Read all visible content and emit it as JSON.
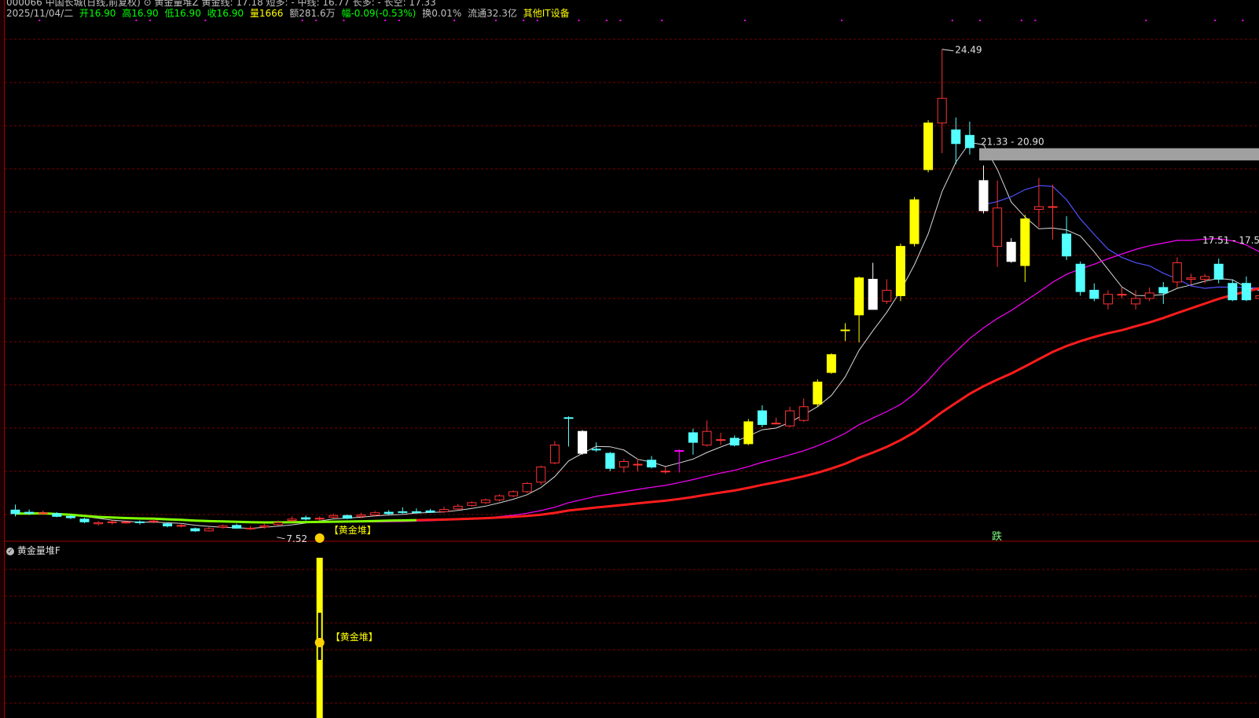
{
  "header": {
    "line1": "000066 中国长城(日线,前复权) ⊙ 黄金量堆Z  黄金线: 17.18  短多: -  中线: 16.77  长多: -  长空: 17.33",
    "date": "2025/11/04/二",
    "open_label": "开",
    "open": "16.90",
    "high_label": "高",
    "high": "16.90",
    "low_label": "低",
    "low": "16.90",
    "close_label": "收",
    "close": "16.90",
    "vol_label": "量",
    "vol": "1666",
    "amount_label": "额",
    "amount": "281.6万",
    "change_label": "幅",
    "change": "-0.09(-0.53%)",
    "turnover_label": "换",
    "turnover": "0.01%",
    "float_label": "流通",
    "float": "32.3亿",
    "sector": "其他IT设备"
  },
  "subchart": {
    "title": "黄金量堆F",
    "signal_label": "【黄金堆】"
  },
  "chart_data": {
    "type": "candlestick",
    "price_range": [
      6.8,
      25.6
    ],
    "annotations": {
      "high": "24.49",
      "low": "7.52",
      "zone": "21.33 - 20.90",
      "right_level": "17.51 - 17.5",
      "signal": "【黄金堆】",
      "marker": "跌"
    },
    "candles": [
      {
        "o": 7.68,
        "c": 7.55,
        "h": 7.88,
        "l": 7.45,
        "s": "cyan"
      },
      {
        "o": 7.6,
        "c": 7.56,
        "h": 7.7,
        "l": 7.5,
        "s": "cyan"
      },
      {
        "o": 7.56,
        "c": 7.58,
        "h": 7.66,
        "l": 7.5,
        "s": "red"
      },
      {
        "o": 7.55,
        "c": 7.45,
        "h": 7.6,
        "l": 7.42,
        "s": "cyan"
      },
      {
        "o": 7.45,
        "c": 7.4,
        "h": 7.52,
        "l": 7.35,
        "s": "cyan"
      },
      {
        "o": 7.35,
        "c": 7.25,
        "h": 7.4,
        "l": 7.2,
        "s": "cyan"
      },
      {
        "o": 7.18,
        "c": 7.22,
        "h": 7.28,
        "l": 7.12,
        "s": "red"
      },
      {
        "o": 7.22,
        "c": 7.25,
        "h": 7.3,
        "l": 7.15,
        "s": "red"
      },
      {
        "o": 7.22,
        "c": 7.24,
        "h": 7.3,
        "l": 7.18,
        "s": "red"
      },
      {
        "o": 7.25,
        "c": 7.22,
        "h": 7.3,
        "l": 7.15,
        "s": "cyan"
      },
      {
        "o": 7.25,
        "c": 7.28,
        "h": 7.35,
        "l": 7.2,
        "s": "red"
      },
      {
        "o": 7.18,
        "c": 7.1,
        "h": 7.22,
        "l": 7.05,
        "s": "cyan"
      },
      {
        "o": 7.1,
        "c": 7.12,
        "h": 7.18,
        "l": 7.05,
        "s": "red"
      },
      {
        "o": 7.0,
        "c": 6.92,
        "h": 7.04,
        "l": 6.88,
        "s": "cyan"
      },
      {
        "o": 6.92,
        "c": 7.0,
        "h": 7.05,
        "l": 6.9,
        "s": "red"
      },
      {
        "o": 7.05,
        "c": 7.1,
        "h": 7.15,
        "l": 7.0,
        "s": "red"
      },
      {
        "o": 7.12,
        "c": 7.02,
        "h": 7.18,
        "l": 7.0,
        "s": "cyan"
      },
      {
        "o": 7.0,
        "c": 7.02,
        "h": 7.1,
        "l": 6.95,
        "s": "red"
      },
      {
        "o": 7.06,
        "c": 7.1,
        "h": 7.2,
        "l": 7.0,
        "s": "red"
      },
      {
        "o": 7.15,
        "c": 7.22,
        "h": 7.3,
        "l": 7.1,
        "s": "red"
      },
      {
        "o": 7.3,
        "c": 7.35,
        "h": 7.45,
        "l": 7.25,
        "s": "red"
      },
      {
        "o": 7.4,
        "c": 7.35,
        "h": 7.48,
        "l": 7.3,
        "s": "cyan"
      },
      {
        "o": 7.35,
        "c": 7.38,
        "h": 7.45,
        "l": 7.3,
        "s": "red"
      },
      {
        "o": 7.42,
        "c": 7.48,
        "h": 7.55,
        "l": 7.38,
        "s": "red"
      },
      {
        "o": 7.48,
        "c": 7.38,
        "h": 7.52,
        "l": 7.35,
        "s": "cyan"
      },
      {
        "o": 7.45,
        "c": 7.5,
        "h": 7.58,
        "l": 7.4,
        "s": "red"
      },
      {
        "o": 7.5,
        "c": 7.58,
        "h": 7.65,
        "l": 7.45,
        "s": "red"
      },
      {
        "o": 7.6,
        "c": 7.55,
        "h": 7.68,
        "l": 7.5,
        "s": "cyan"
      },
      {
        "o": 7.62,
        "c": 7.6,
        "h": 7.78,
        "l": 7.55,
        "s": "cyan"
      },
      {
        "o": 7.62,
        "c": 7.62,
        "h": 7.74,
        "l": 7.55,
        "s": "cyan"
      },
      {
        "o": 7.65,
        "c": 7.6,
        "h": 7.72,
        "l": 7.58,
        "s": "cyan"
      },
      {
        "o": 7.62,
        "c": 7.7,
        "h": 7.8,
        "l": 7.58,
        "s": "red"
      },
      {
        "o": 7.72,
        "c": 7.82,
        "h": 7.9,
        "l": 7.68,
        "s": "red"
      },
      {
        "o": 7.85,
        "c": 7.95,
        "h": 8.0,
        "l": 7.8,
        "s": "red"
      },
      {
        "o": 7.95,
        "c": 8.05,
        "h": 8.1,
        "l": 7.9,
        "s": "red"
      },
      {
        "o": 8.05,
        "c": 8.2,
        "h": 8.25,
        "l": 8.0,
        "s": "red"
      },
      {
        "o": 8.2,
        "c": 8.35,
        "h": 8.4,
        "l": 8.15,
        "s": "red"
      },
      {
        "o": 8.35,
        "c": 8.65,
        "h": 8.7,
        "l": 8.3,
        "s": "red"
      },
      {
        "o": 8.7,
        "c": 9.25,
        "h": 9.3,
        "l": 8.6,
        "s": "red"
      },
      {
        "o": 9.4,
        "c": 10.05,
        "h": 10.2,
        "l": 9.35,
        "s": "red"
      },
      {
        "o": 11.05,
        "c": 11.05,
        "h": 11.1,
        "l": 10.0,
        "s": "cyan"
      },
      {
        "o": 10.55,
        "c": 9.75,
        "h": 10.6,
        "l": 9.7,
        "s": "white"
      },
      {
        "o": 9.9,
        "c": 9.9,
        "h": 10.15,
        "l": 9.8,
        "s": "cyan"
      },
      {
        "o": 9.75,
        "c": 9.2,
        "h": 9.8,
        "l": 9.1,
        "s": "cyan"
      },
      {
        "o": 9.25,
        "c": 9.45,
        "h": 9.55,
        "l": 9.05,
        "s": "red"
      },
      {
        "o": 9.35,
        "c": 9.35,
        "h": 9.55,
        "l": 9.1,
        "s": "red"
      },
      {
        "o": 9.5,
        "c": 9.25,
        "h": 9.65,
        "l": 9.2,
        "s": "cyan"
      },
      {
        "o": 9.1,
        "c": 9.1,
        "h": 9.25,
        "l": 9.0,
        "s": "red"
      },
      {
        "o": 9.85,
        "c": 9.85,
        "h": 9.9,
        "l": 9.05,
        "s": "magenta"
      },
      {
        "o": 10.5,
        "c": 10.15,
        "h": 10.65,
        "l": 9.7,
        "s": "cyan"
      },
      {
        "o": 10.05,
        "c": 10.55,
        "h": 10.95,
        "l": 10.0,
        "s": "red"
      },
      {
        "o": 10.25,
        "c": 10.25,
        "h": 10.5,
        "l": 10.05,
        "s": "red"
      },
      {
        "o": 10.3,
        "c": 10.05,
        "h": 10.4,
        "l": 10.0,
        "s": "cyan"
      },
      {
        "o": 10.1,
        "c": 10.9,
        "h": 11.0,
        "l": 10.05,
        "s": "yellow"
      },
      {
        "o": 10.8,
        "c": 11.3,
        "h": 11.5,
        "l": 10.7,
        "s": "cyan"
      },
      {
        "o": 10.85,
        "c": 10.85,
        "h": 11.05,
        "l": 10.8,
        "s": "red"
      },
      {
        "o": 10.75,
        "c": 11.3,
        "h": 11.45,
        "l": 10.7,
        "s": "red"
      },
      {
        "o": 10.95,
        "c": 11.45,
        "h": 11.75,
        "l": 10.9,
        "s": "red"
      },
      {
        "o": 11.55,
        "c": 12.35,
        "h": 12.45,
        "l": 11.45,
        "s": "yellow"
      },
      {
        "o": 12.7,
        "c": 13.35,
        "h": 13.4,
        "l": 12.65,
        "s": "yellow"
      },
      {
        "o": 14.25,
        "c": 14.25,
        "h": 14.5,
        "l": 13.85,
        "s": "yellow"
      },
      {
        "o": 14.8,
        "c": 16.15,
        "h": 16.2,
        "l": 13.8,
        "s": "yellow"
      },
      {
        "o": 16.1,
        "c": 15.0,
        "h": 16.7,
        "l": 15.0,
        "s": "white"
      },
      {
        "o": 15.3,
        "c": 15.7,
        "h": 16.1,
        "l": 15.2,
        "s": "red"
      },
      {
        "o": 15.5,
        "c": 17.3,
        "h": 17.4,
        "l": 15.3,
        "s": "yellow"
      },
      {
        "o": 17.4,
        "c": 19.0,
        "h": 19.1,
        "l": 17.3,
        "s": "yellow"
      },
      {
        "o": 20.1,
        "c": 21.8,
        "h": 21.9,
        "l": 20.0,
        "s": "yellow"
      },
      {
        "o": 21.8,
        "c": 22.7,
        "h": 24.49,
        "l": 20.7,
        "s": "red"
      },
      {
        "o": 21.55,
        "c": 21.05,
        "h": 22.0,
        "l": 20.3,
        "s": "cyan"
      },
      {
        "o": 21.35,
        "c": 20.9,
        "h": 21.85,
        "l": 20.65,
        "s": "cyan"
      },
      {
        "o": 19.7,
        "c": 18.6,
        "h": 20.25,
        "l": 18.5,
        "s": "white"
      },
      {
        "o": 18.7,
        "c": 17.3,
        "h": 19.7,
        "l": 16.55,
        "s": "red"
      },
      {
        "o": 17.45,
        "c": 16.75,
        "h": 17.6,
        "l": 16.7,
        "s": "white"
      },
      {
        "o": 16.6,
        "c": 18.3,
        "h": 18.45,
        "l": 16.0,
        "s": "yellow"
      },
      {
        "o": 18.65,
        "c": 18.75,
        "h": 19.8,
        "l": 18.0,
        "s": "red"
      },
      {
        "o": 18.75,
        "c": 18.75,
        "h": 19.55,
        "l": 17.55,
        "s": "red"
      },
      {
        "o": 17.75,
        "c": 16.95,
        "h": 18.4,
        "l": 16.8,
        "s": "cyan"
      },
      {
        "o": 16.65,
        "c": 15.65,
        "h": 16.75,
        "l": 15.5,
        "s": "cyan"
      },
      {
        "o": 15.7,
        "c": 15.4,
        "h": 15.95,
        "l": 15.3,
        "s": "cyan"
      },
      {
        "o": 15.2,
        "c": 15.55,
        "h": 15.7,
        "l": 15.0,
        "s": "red"
      },
      {
        "o": 15.55,
        "c": 15.55,
        "h": 15.8,
        "l": 15.4,
        "s": "red"
      },
      {
        "o": 15.2,
        "c": 15.4,
        "h": 15.7,
        "l": 15.0,
        "s": "red"
      },
      {
        "o": 15.4,
        "c": 15.6,
        "h": 15.8,
        "l": 15.3,
        "s": "red"
      },
      {
        "o": 15.8,
        "c": 15.6,
        "h": 16.0,
        "l": 15.2,
        "s": "cyan"
      },
      {
        "o": 16.0,
        "c": 16.7,
        "h": 16.9,
        "l": 15.8,
        "s": "red"
      },
      {
        "o": 16.1,
        "c": 16.15,
        "h": 16.3,
        "l": 15.9,
        "s": "red"
      },
      {
        "o": 16.2,
        "c": 16.1,
        "h": 16.3,
        "l": 15.95,
        "s": "red"
      },
      {
        "o": 16.65,
        "c": 16.1,
        "h": 16.85,
        "l": 15.95,
        "s": "cyan"
      },
      {
        "o": 15.95,
        "c": 15.35,
        "h": 16.1,
        "l": 15.3,
        "s": "cyan"
      },
      {
        "o": 15.95,
        "c": 15.35,
        "h": 16.2,
        "l": 15.3,
        "s": "cyan"
      },
      {
        "o": 15.4,
        "c": 15.5,
        "h": 15.7,
        "l": 15.3,
        "s": "red"
      },
      {
        "o": 15.5,
        "c": 15.4,
        "h": 15.6,
        "l": 15.3,
        "s": "cyan"
      }
    ]
  }
}
